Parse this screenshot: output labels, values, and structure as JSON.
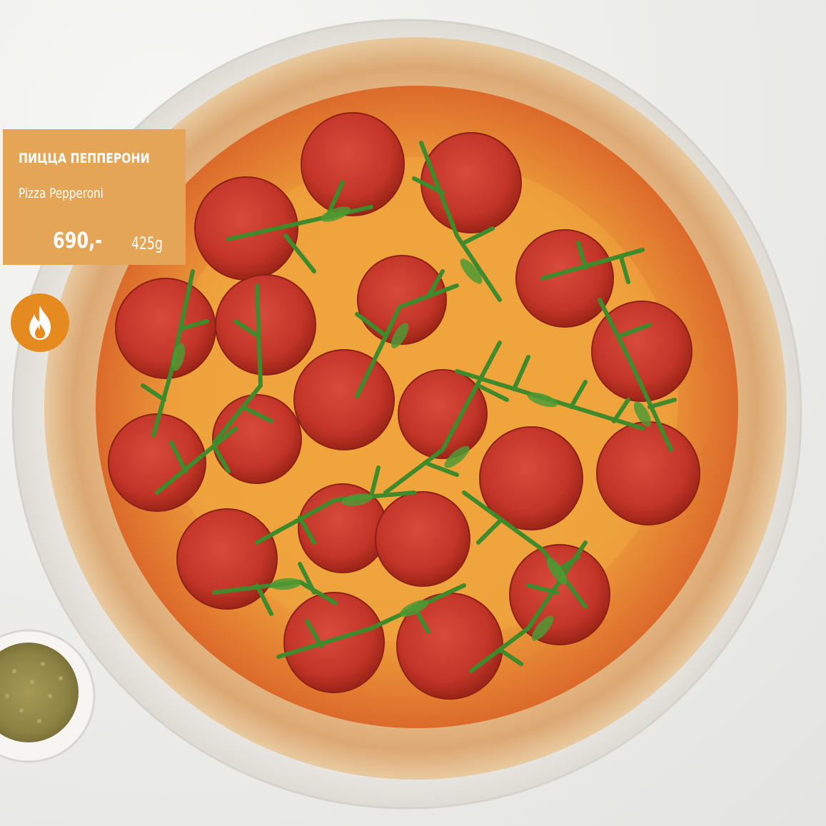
{
  "product": {
    "name_ru": "ПИЦЦА ПЕППЕРОНИ",
    "name_en": "Pizza Pepperoni",
    "price": "690,-",
    "weight": "425g"
  },
  "badge": {
    "icon": "flame-icon"
  },
  "colors": {
    "card": "#e5a556",
    "badge": "#e58a1e",
    "text": "#ffffff"
  }
}
